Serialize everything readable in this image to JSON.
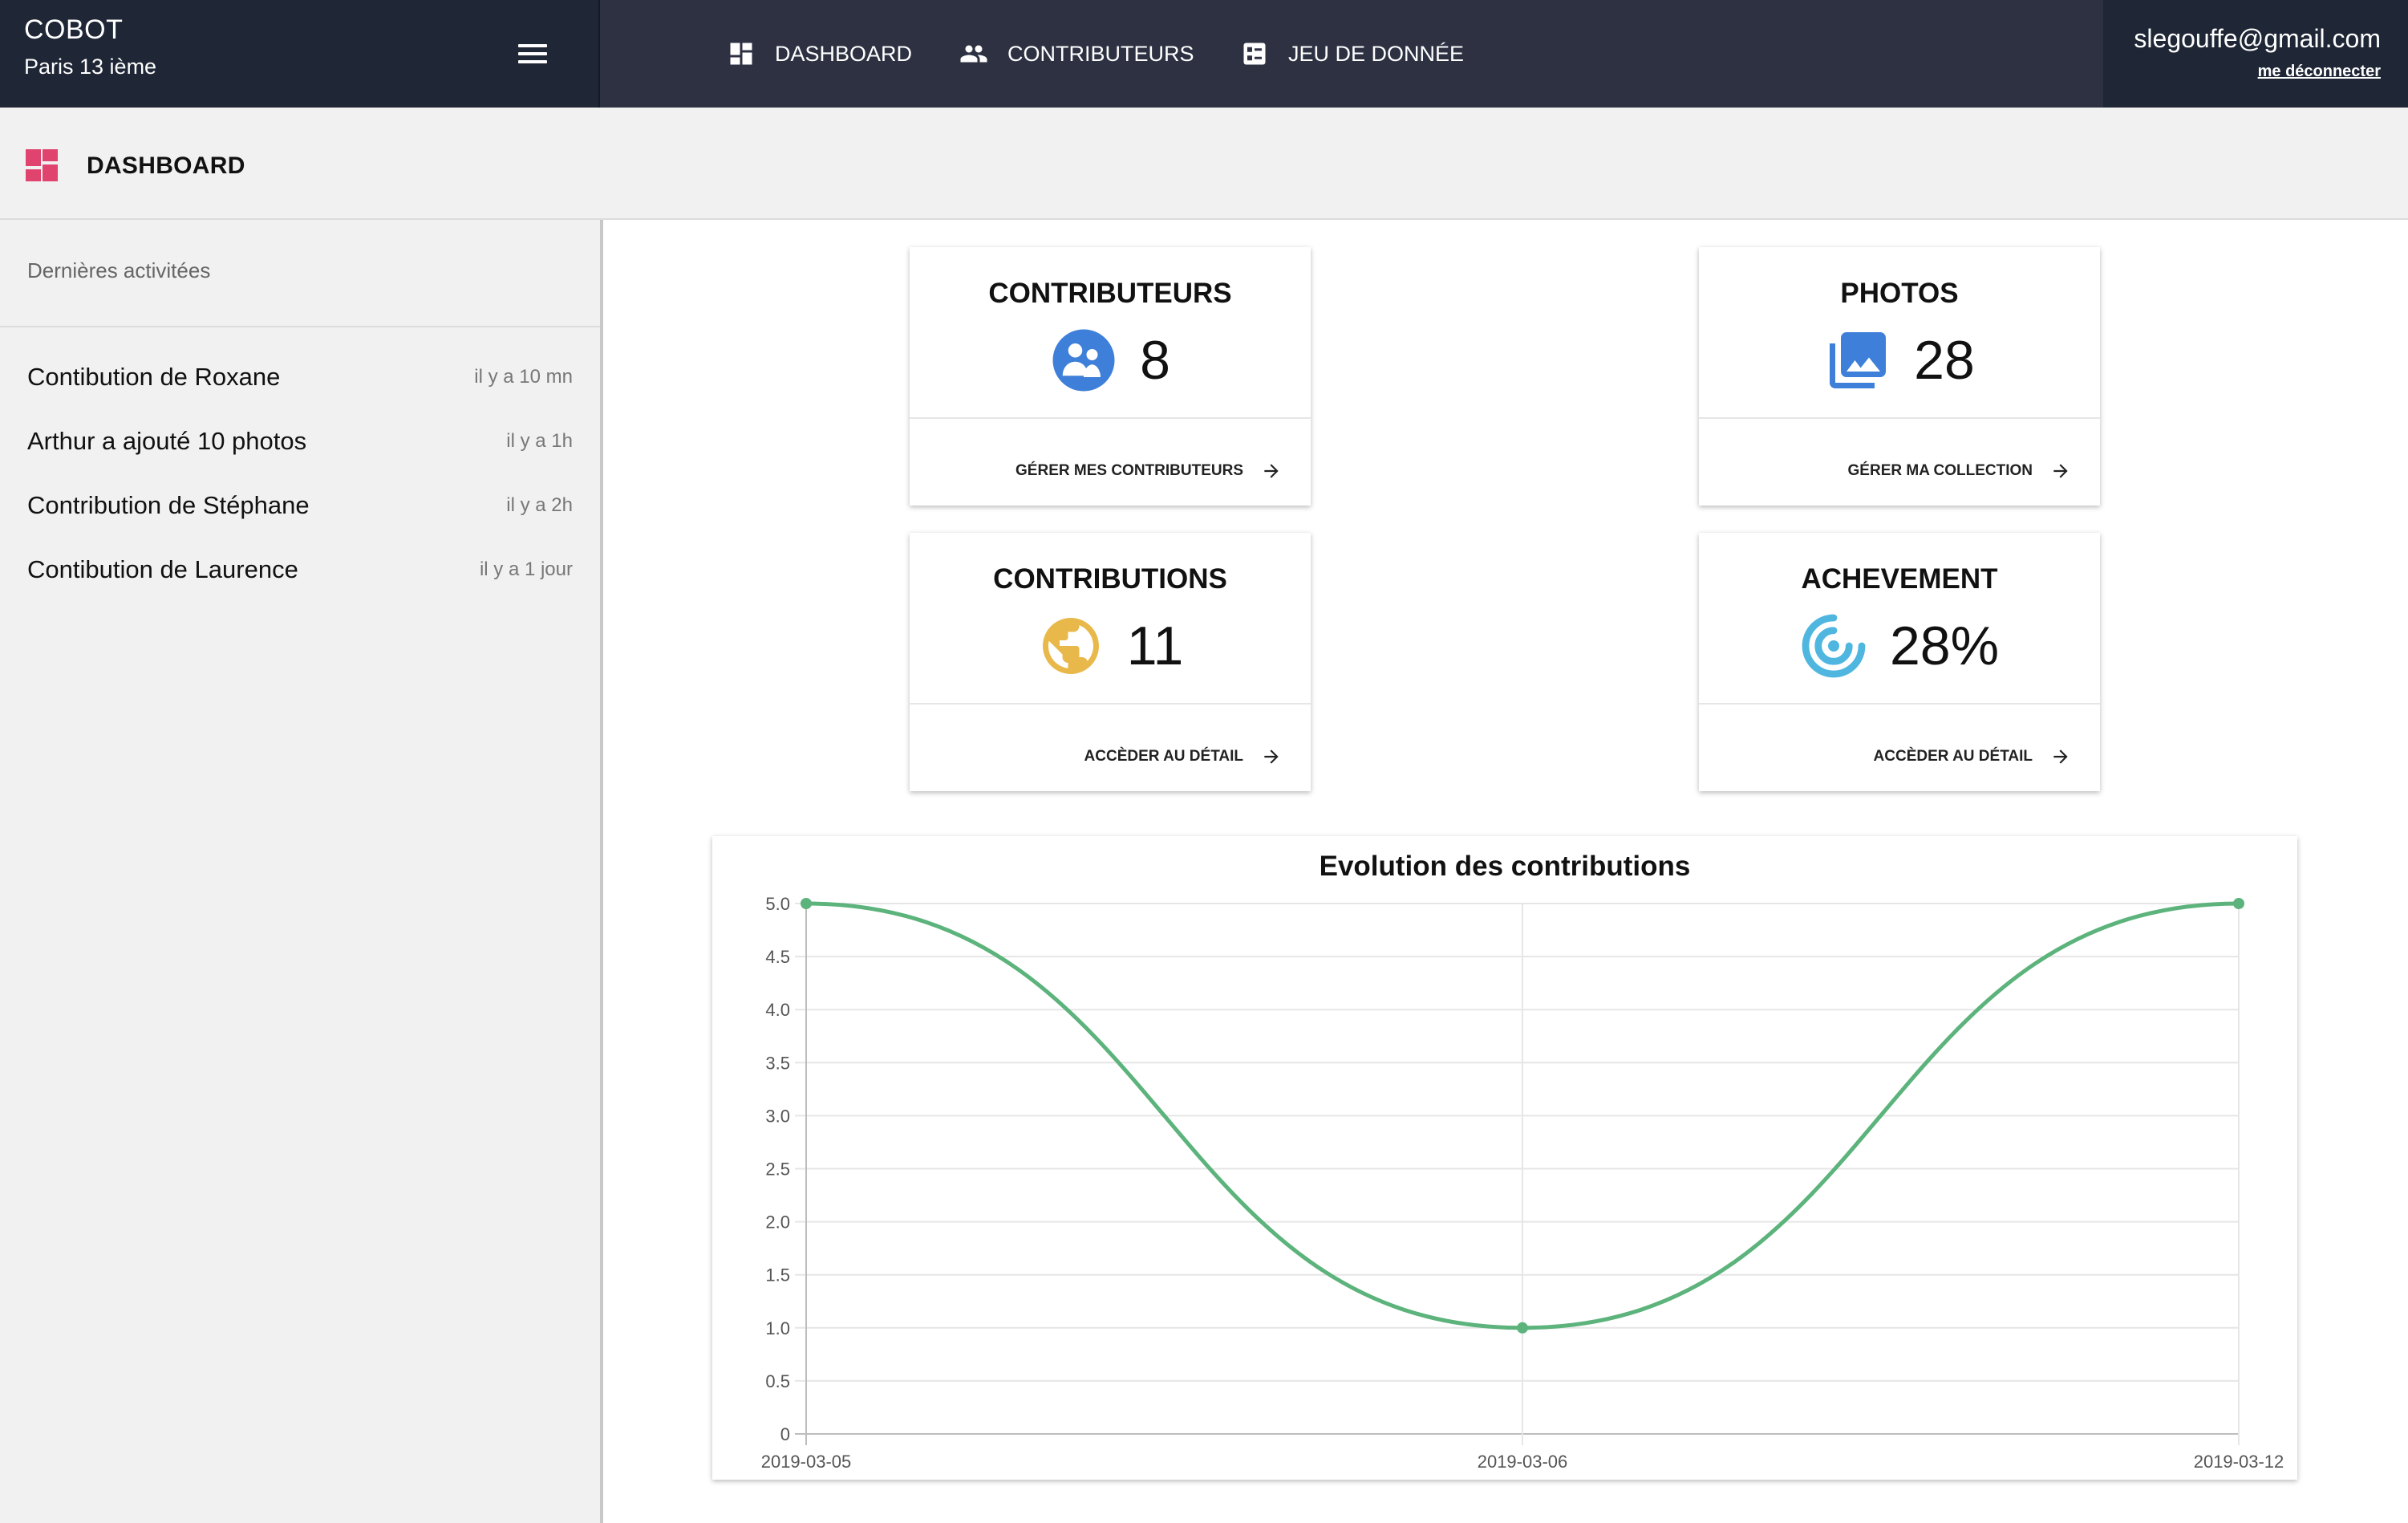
{
  "brand": {
    "name": "COBOT",
    "subtitle": "Paris 13 ième",
    "menu_icon": "hamburger-menu-icon"
  },
  "nav": [
    {
      "label": "DASHBOARD",
      "icon": "dashboard-icon"
    },
    {
      "label": "CONTRIBUTEURS",
      "icon": "people-icon"
    },
    {
      "label": "JEU DE DONNÉE",
      "icon": "dataset-list-icon"
    }
  ],
  "user": {
    "email": "slegouffe@gmail.com",
    "logout": "me déconnecter"
  },
  "page": {
    "title": "DASHBOARD",
    "icon": "dashboard-icon",
    "accent": "#e0436e"
  },
  "sidebar": {
    "title": "Dernières activitées",
    "items": [
      {
        "text": "Contibution de Roxane",
        "time": "il y a 10 mn"
      },
      {
        "text": "Arthur a ajouté 10 photos",
        "time": "il y a 1h"
      },
      {
        "text": "Contribution de Stéphane",
        "time": "il y a 2h"
      },
      {
        "text": "Contibution de Laurence",
        "time": "il y a 1 jour"
      }
    ]
  },
  "cards": {
    "contributeurs": {
      "title": "CONTRIBUTEURS",
      "value": "8",
      "link": "GÉRER MES CONTRIBUTEURS",
      "icon": "contributors-icon",
      "color": "#3d7fd9"
    },
    "photos": {
      "title": "PHOTOS",
      "value": "28",
      "link": "GÉRER MA COLLECTION",
      "icon": "photo-library-icon",
      "color": "#3d7fd9"
    },
    "contributions": {
      "title": "CONTRIBUTIONS",
      "value": "11",
      "link": "ACCÈDER AU DÉTAIL",
      "icon": "globe-icon",
      "color": "#e8b94a"
    },
    "achevement": {
      "title": "ACHEVEMENT",
      "value": "28%",
      "link": "ACCÈDER AU DÉTAIL",
      "icon": "target-icon",
      "color": "#4fb6e0"
    }
  },
  "chart_data": {
    "type": "line",
    "title": "Evolution des contributions",
    "x": [
      "2019-03-05",
      "2019-03-06",
      "2019-03-12"
    ],
    "series": [
      {
        "values": [
          5,
          1,
          5
        ],
        "color": "#5cb37c"
      }
    ],
    "yticks": [
      "0",
      "0.5",
      "1.0",
      "1.5",
      "2.0",
      "2.5",
      "3.0",
      "3.5",
      "4.0",
      "4.5",
      "5.0"
    ],
    "ylim": [
      0,
      5
    ],
    "grid": true,
    "smooth": true
  }
}
